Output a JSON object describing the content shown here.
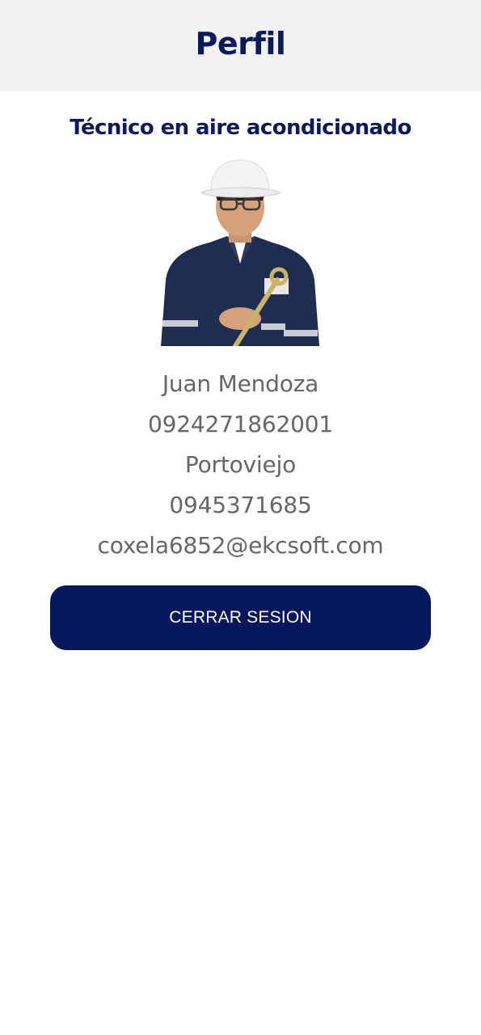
{
  "header": {
    "title": "Perfil"
  },
  "profile": {
    "role": "Técnico en aire acondicionado",
    "name": "Juan Mendoza",
    "id_number": "0924271862001",
    "city": "Portoviejo",
    "phone": "0945371685",
    "email": "coxela6852@ekcsoft.com",
    "photo_alt": "profile-photo"
  },
  "actions": {
    "logout_label": "CERRAR SESION"
  },
  "colors": {
    "brand_navy": "#06175c",
    "title_navy": "#0a1a5c",
    "info_gray": "#666666",
    "header_bg": "#f2f2f2"
  }
}
